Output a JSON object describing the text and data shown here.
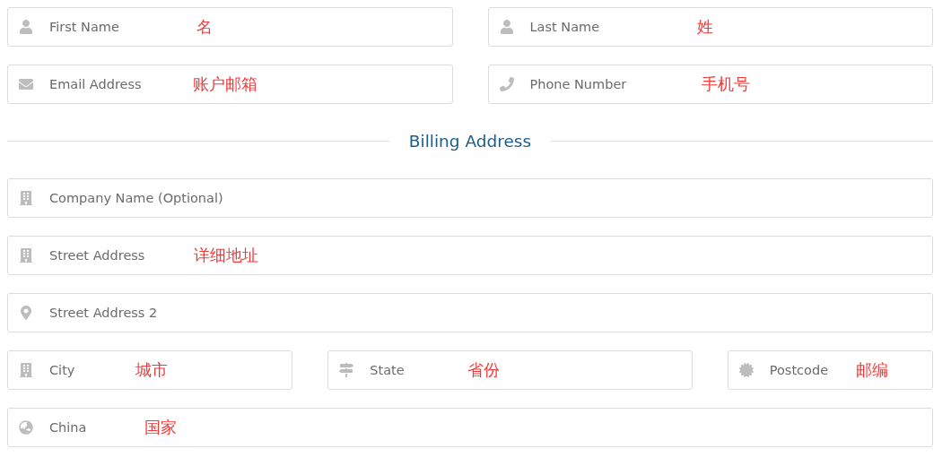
{
  "personal": {
    "rows": [
      {
        "fields": [
          {
            "placeholder": "First Name",
            "annotation": "名"
          },
          {
            "placeholder": "Last Name",
            "annotation": "姓"
          }
        ]
      },
      {
        "fields": [
          {
            "placeholder": "Email Address",
            "annotation": "账户邮箱"
          },
          {
            "placeholder": "Phone Number",
            "annotation": "手机号"
          }
        ]
      }
    ]
  },
  "billing": {
    "heading": "Billing Address",
    "rows": [
      {
        "fields": [
          {
            "placeholder": "Company Name (Optional)"
          }
        ]
      },
      {
        "fields": [
          {
            "placeholder": "Street Address",
            "annotation": "详细地址"
          }
        ]
      },
      {
        "fields": [
          {
            "placeholder": "Street Address 2"
          }
        ]
      },
      {
        "fields": [
          {
            "placeholder": "City",
            "annotation": "城市"
          },
          {
            "placeholder": "State",
            "annotation": "省份"
          },
          {
            "placeholder": "Postcode",
            "annotation": "邮编"
          }
        ]
      },
      {
        "fields": [
          {
            "value": "China",
            "annotation": "国家"
          }
        ]
      }
    ]
  }
}
